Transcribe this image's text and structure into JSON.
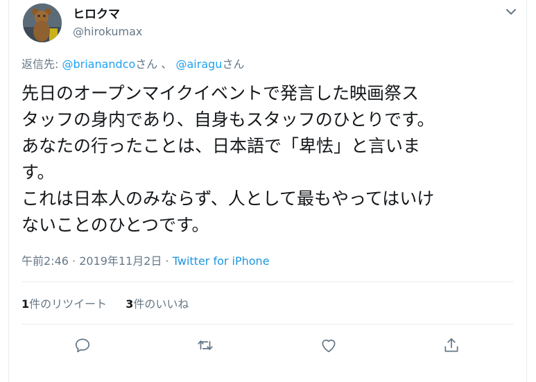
{
  "author": {
    "name": "ヒロクマ",
    "handle": "@hirokumax",
    "avatar_icon": "teddy-bear-avatar"
  },
  "menu": {
    "icon": "chevron-down-icon"
  },
  "reply": {
    "prefix": "返信先: ",
    "mentions": [
      {
        "handle": "@brianandco",
        "suffix": "さん"
      },
      {
        "handle": "@airagu",
        "suffix": "さん"
      }
    ],
    "separator": " 、 "
  },
  "tweet": {
    "lines": [
      "先日のオープンマイクイベントで発言した映画祭ス",
      "タッフの身内であり、自身もスタッフのひとりです。",
      "あなたの行ったことは、日本語で「卑怯」と言いま",
      "す。",
      "これは日本人のみならず、人として最もやってはいけ",
      "ないことのひとつです。"
    ]
  },
  "meta": {
    "time": "午前2:46",
    "dot": " · ",
    "date": "2019年11月2日",
    "source": "Twitter for iPhone"
  },
  "stats": {
    "retweets": {
      "count": "1",
      "label": "件のリツイート"
    },
    "likes": {
      "count": "3",
      "label": "件のいいね"
    }
  },
  "actions": [
    {
      "name": "reply",
      "icon": "reply-icon"
    },
    {
      "name": "retweet",
      "icon": "retweet-icon"
    },
    {
      "name": "like",
      "icon": "heart-icon"
    },
    {
      "name": "share",
      "icon": "share-icon"
    }
  ],
  "colors": {
    "link": "#1da1f2",
    "muted": "#657786",
    "text": "#14171a",
    "border": "#e6ecf0"
  }
}
